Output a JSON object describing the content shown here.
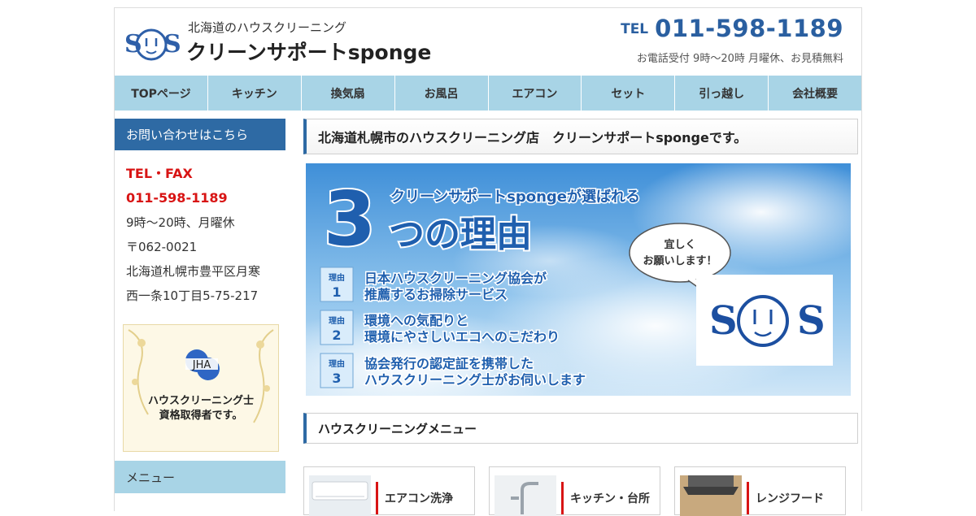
{
  "header": {
    "tagline": "北海道のハウスクリーニング",
    "site_name": "クリーンサポートsponge",
    "tel_label": "TEL",
    "tel_number": "011-598-1189",
    "hours": "お電話受付 9時〜20時 月曜休、お見積無料",
    "logo_text": "S S"
  },
  "nav": {
    "items": [
      {
        "label": "TOPページ"
      },
      {
        "label": "キッチン"
      },
      {
        "label": "換気扇"
      },
      {
        "label": "お風呂"
      },
      {
        "label": "エアコン"
      },
      {
        "label": "セット"
      },
      {
        "label": "引っ越し"
      },
      {
        "label": "会社概要"
      }
    ]
  },
  "sidebar": {
    "contact_head": "お問い合わせはこちら",
    "tel_fax": "TEL・FAX",
    "phone": "011-598-1189",
    "hours": "9時〜20時、月曜休",
    "postal": "〒062-0021",
    "address1": "北海道札幌市豊平区月寒",
    "address2": "西一条10丁目5-75-217",
    "jha_logo": "JHA",
    "jha_line1": "ハウスクリーニング士",
    "jha_line2": "資格取得者です。",
    "menu_head": "メニュー"
  },
  "main": {
    "headline": "北海道札幌市のハウスクリーニング店　クリーンサポートspongeです。",
    "banner": {
      "big_number": "3",
      "subtitle": "クリーンサポートspongeが選ばれる",
      "title_rest": "つの理由",
      "bubble_line1": "宜しく",
      "bubble_line2": "お願いします！",
      "reason_tag": "理由",
      "reasons": [
        {
          "num": "1",
          "line1": "日本ハウスクリーニング協会が",
          "line2": "推薦するお掃除サービス"
        },
        {
          "num": "2",
          "line1": "環境への気配りと",
          "line2": "環境にやさしいエコへのこだわり"
        },
        {
          "num": "3",
          "line1": "協会発行の認定証を携帯した",
          "line2": "ハウスクリーニング士がお伺いします"
        }
      ]
    },
    "menu_head": "ハウスクリーニングメニュー",
    "cards": [
      {
        "label": "エアコン洗浄"
      },
      {
        "label": "キッチン・台所"
      },
      {
        "label": "レンジフード"
      }
    ]
  }
}
